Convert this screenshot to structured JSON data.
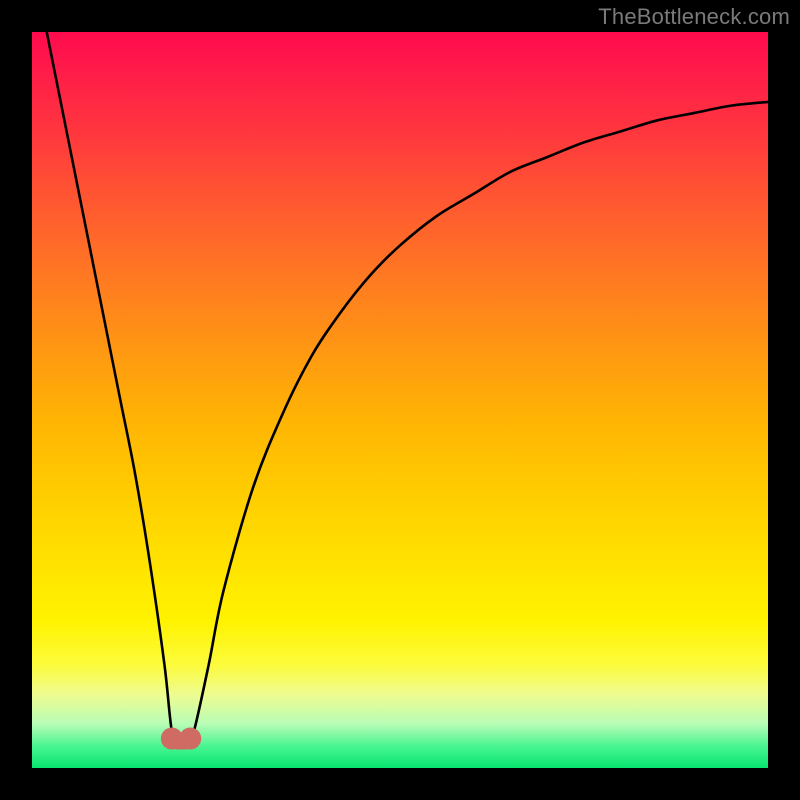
{
  "watermark": "TheBottleneck.com",
  "chart_data": {
    "type": "line",
    "title": "",
    "xlabel": "",
    "ylabel": "",
    "xlim": [
      0,
      100
    ],
    "ylim": [
      0,
      100
    ],
    "grid": false,
    "legend": false,
    "series": [
      {
        "name": "bottleneck-curve",
        "x": [
          2,
          4,
          6,
          8,
          10,
          12,
          14,
          16,
          18,
          19,
          20,
          21,
          22,
          24,
          26,
          30,
          34,
          38,
          42,
          46,
          50,
          55,
          60,
          65,
          70,
          75,
          80,
          85,
          90,
          95,
          100
        ],
        "values": [
          100,
          90,
          80,
          70,
          60,
          50,
          40,
          28,
          14,
          5,
          3,
          3,
          5,
          14,
          24,
          38,
          48,
          56,
          62,
          67,
          71,
          75,
          78,
          81,
          83,
          85,
          86.5,
          88,
          89,
          90,
          90.5
        ]
      }
    ],
    "markers": [
      {
        "name": "min-left",
        "x": 19.0,
        "y": 4.0
      },
      {
        "name": "min-right",
        "x": 21.5,
        "y": 4.0
      }
    ],
    "marker_color": "#cf6b62",
    "line_color": "#000000"
  }
}
